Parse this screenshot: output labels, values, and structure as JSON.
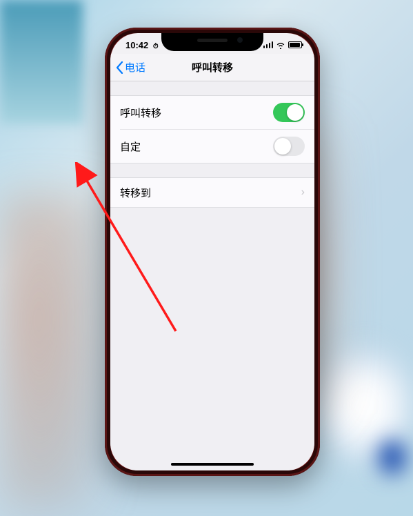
{
  "status_bar": {
    "time": "10:42",
    "has_alarm": true
  },
  "nav": {
    "back_label": "电话",
    "title": "呼叫转移"
  },
  "settings": {
    "group1": [
      {
        "label": "呼叫转移",
        "toggle": "on"
      },
      {
        "label": "自定",
        "toggle": "off"
      }
    ],
    "group2": [
      {
        "label": "转移到",
        "type": "disclosure"
      }
    ]
  }
}
